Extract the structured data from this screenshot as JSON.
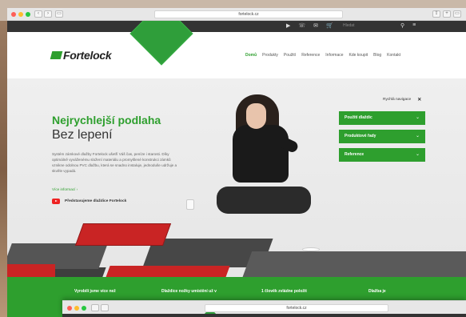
{
  "chrome": {
    "url": "fortelock.cz",
    "dot_colors": [
      "#fe5f57",
      "#febc2e",
      "#28c840"
    ],
    "back": "‹",
    "forward": "›",
    "sidebar": "▭",
    "right_icons": [
      "⇪",
      "+",
      "▭"
    ]
  },
  "topbar": {
    "icons": [
      "youtube-icon",
      "phone-icon",
      "mail-icon",
      "cart-icon"
    ],
    "icon_glyphs": [
      "▶",
      "☏",
      "✉",
      "🛒"
    ],
    "search_placeholder": "Hledat",
    "right_glyphs": [
      "⚲",
      "≡"
    ]
  },
  "logo": {
    "text": "Fortelock"
  },
  "menu": {
    "items": [
      "Domů",
      "Produkty",
      "Použití",
      "Reference",
      "Informace",
      "Kde koupit",
      "Blog",
      "Kontakt"
    ]
  },
  "hero": {
    "title_green": "Nejrychlejší podlaha",
    "title_dark": "Bez lepení",
    "description": "Systém zámkové dlažby Fortelock ušetří Váš čas, peníze i starosti. Díky optimálně vyváženému složení materiálu a promyšlené konstrukci zámků vznikne odolnou PVC dlažbu, která se snadno instaluje, jednoduše udržuje a skvěle vypadá.",
    "more_link": "Více informací  ›",
    "video_label": "Představujeme dlaždice Fortelock"
  },
  "quick_nav": {
    "label": "Rychlá navigace",
    "close": "✕",
    "panels": [
      "Použití dlaždic",
      "Produktové řady",
      "Reference"
    ],
    "chevron": "⌄"
  },
  "features": [
    "Vyrobili jsme více než",
    "Dlaždice nožky umístění už v",
    "1 člověk zvládne položit",
    "Dlažba je"
  ],
  "shot2": {
    "url": "fortelock.cz"
  },
  "colors": {
    "brand_green": "#2e9f2e",
    "tile_red": "#c92424",
    "topbar": "#333333"
  }
}
